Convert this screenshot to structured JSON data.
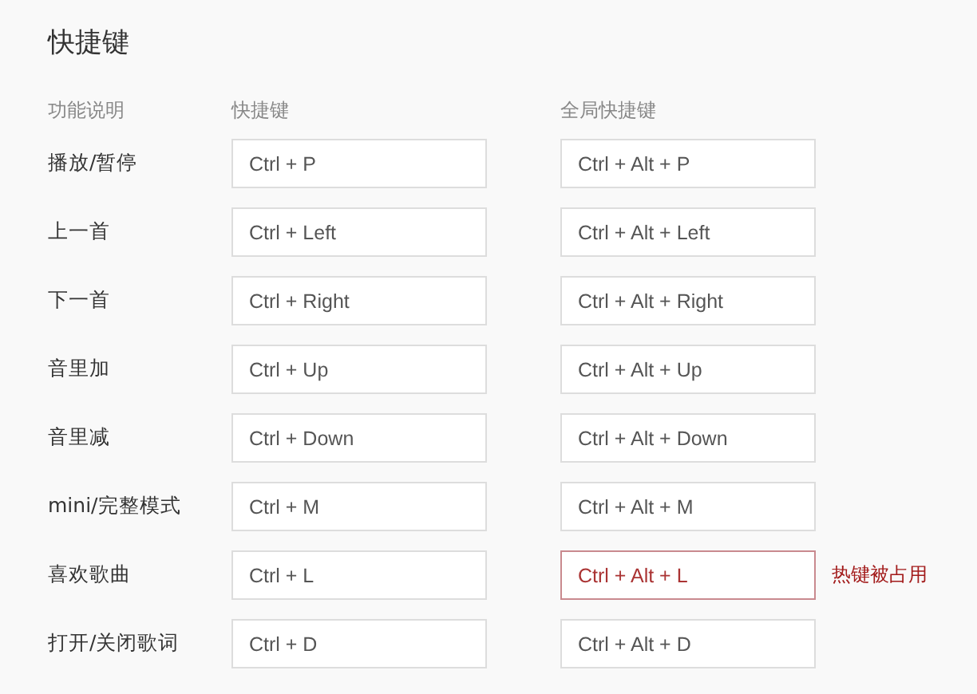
{
  "title": "快捷键",
  "columns": [
    "功能说明",
    "快捷键",
    "全局快捷键"
  ],
  "rows": [
    {
      "action": "播放/暂停",
      "shortcut": "Ctrl + P",
      "global": "Ctrl + Alt + P",
      "conflict": false
    },
    {
      "action": "上一首",
      "shortcut": "Ctrl + Left",
      "global": "Ctrl + Alt + Left",
      "conflict": false
    },
    {
      "action": "下一首",
      "shortcut": "Ctrl + Right",
      "global": "Ctrl + Alt + Right",
      "conflict": false
    },
    {
      "action": "音里加",
      "shortcut": "Ctrl + Up",
      "global": "Ctrl + Alt + Up",
      "conflict": false
    },
    {
      "action": "音里减",
      "shortcut": "Ctrl + Down",
      "global": "Ctrl + Alt + Down",
      "conflict": false
    },
    {
      "action": "mini/完整模式",
      "shortcut": "Ctrl + M",
      "global": "Ctrl + Alt + M",
      "conflict": false
    },
    {
      "action": "喜欢歌曲",
      "shortcut": "Ctrl + L",
      "global": "Ctrl + Alt + L",
      "conflict": true,
      "warning": "热键被占用"
    },
    {
      "action": "打开/关闭歌词",
      "shortcut": "Ctrl + D",
      "global": "Ctrl + Alt + D",
      "conflict": false
    }
  ]
}
